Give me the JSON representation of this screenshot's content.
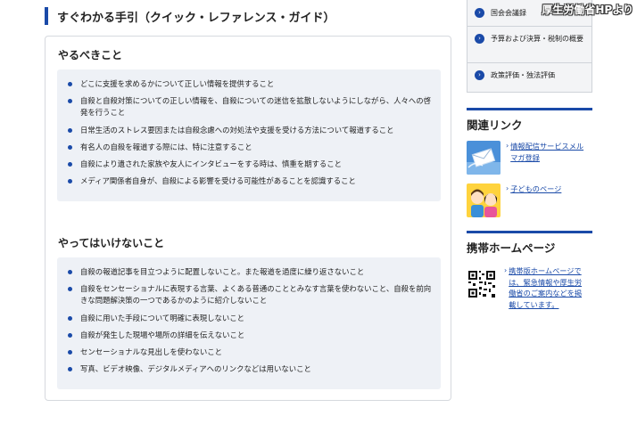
{
  "page": {
    "heading": "すぐわかる手引（クイック・レファレンス・ガイド）"
  },
  "do_section": {
    "title": "やるべきこと",
    "items": [
      "どこに支援を求めるかについて正しい情報を提供すること",
      "自殺と自殺対策についての正しい情報を、自殺についての迷信を拡散しないようにしながら、人々への啓発を行うこと",
      "日常生活のストレス要因または自殺念慮への対処法や支援を受ける方法について報道すること",
      "有名人の自殺を報道する際には、特に注意すること",
      "自殺により遺された家族や友人にインタビューをする時は、慎重を期すること",
      "メディア関係者自身が、自殺による影響を受ける可能性があることを認識すること"
    ]
  },
  "dont_section": {
    "title": "やってはいけないこと",
    "items": [
      "自殺の報道記事を目立つように配置しないこと。また報道を過度に繰り返さないこと",
      "自殺をセンセーショナルに表現する言葉、よくある普通のこととみなす言葉を使わないこと、自殺を前向きな問題解決策の一つであるかのように紹介しないこと",
      "自殺に用いた手段について明確に表現しないこと",
      "自殺が発生した現場や場所の詳細を伝えないこと",
      "センセーショナルな見出しを使わないこと",
      "写真、ビデオ映像、デジタルメディアへのリンクなどは用いないこと"
    ]
  },
  "sidebar": {
    "nav_items": [
      {
        "label": "国会会議録"
      },
      {
        "label": "予算および決算・税制の概要"
      },
      {
        "label": "政策評価・独法評価"
      }
    ],
    "related_heading": "関連リンク",
    "related_links": [
      {
        "label": "情報配信サービスメルマガ登録",
        "icon": "mail-icon"
      },
      {
        "label": "子どものページ",
        "icon": "children-icon"
      }
    ],
    "mobile_heading": "携帯ホームページ",
    "mobile_link": {
      "label": "携帯版ホームページでは、緊急情報や厚生労働省のご案内などを掲載しています。",
      "icon": "qr-code-icon"
    },
    "arrow_glyph": "›",
    "nav_glyph": "›"
  },
  "watermark": "厚生労働省HPより",
  "colors": {
    "accent": "#1a4aa8",
    "panel": "#eef1f6"
  }
}
